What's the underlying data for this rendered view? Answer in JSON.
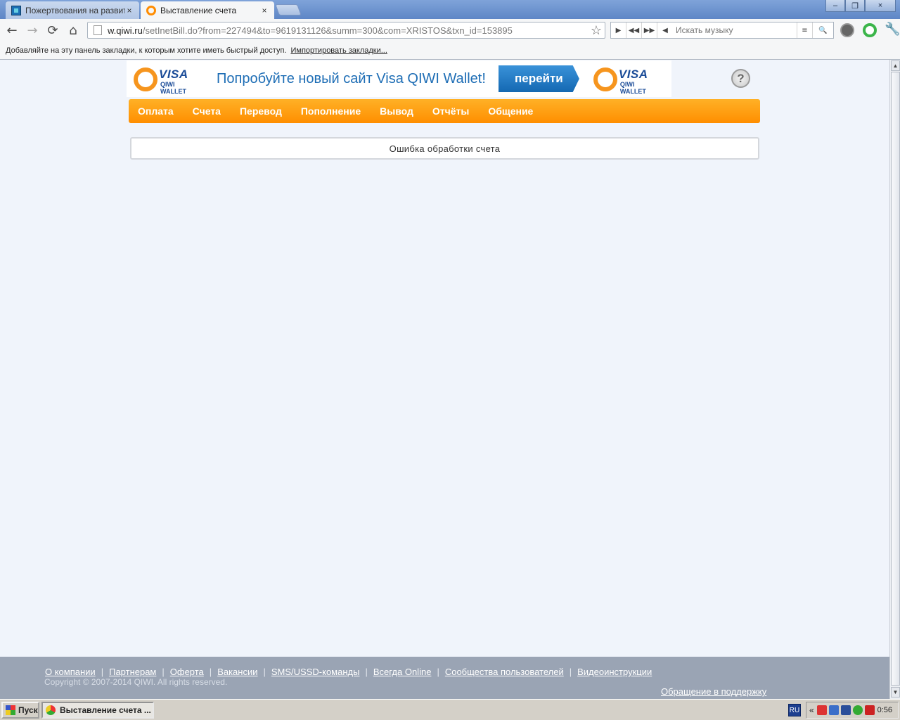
{
  "browser": {
    "tabs": [
      {
        "title": "Пожертвования на развити",
        "close": "×",
        "active": false,
        "icon": "grid-favicon"
      },
      {
        "title": "Выставление счета",
        "close": "×",
        "active": true,
        "icon": "qiwi-favicon"
      }
    ],
    "window_controls": {
      "minimize": "–",
      "maximize": "❐",
      "close": "×"
    },
    "nav": {
      "back": "←",
      "forward": "→",
      "reload": "⟳",
      "home": "⌂"
    },
    "url": {
      "host": "w.qiwi.ru",
      "path": "/setInetBill.do?from=227494&to=9619131126&summ=300&com=XRISTOS&txn_id=153895"
    },
    "star": "☆",
    "music": {
      "play": "▶",
      "prev": "◀◀",
      "next": "▶▶",
      "volume": "◀",
      "placeholder": "Искать музыку",
      "menu": "≡",
      "search": "🔍"
    },
    "wrench": "🔧",
    "bookmarks": {
      "hint": "Добавляйте на эту панель закладки, к которым хотите иметь быстрый доступ.",
      "import_link": "Импортировать закладки..."
    }
  },
  "banner": {
    "logo_visa": "VISA",
    "logo_wallet": "QIWI WALLET",
    "text": "Попробуйте новый сайт Visa QIWI Wallet!",
    "go_button": "перейти"
  },
  "help": "?",
  "nav": [
    "Оплата",
    "Счета",
    "Перевод",
    "Пополнение",
    "Вывод",
    "Отчёты",
    "Общение"
  ],
  "error_message": "Ошибка обработки счета",
  "footer": {
    "links": [
      "О компании",
      "Партнерам",
      "Оферта",
      "Вакансии",
      "SMS/USSD-команды",
      "Всегда Online",
      "Сообщества пользователей",
      "Видеоинструкции"
    ],
    "separator": "|",
    "copyright": "Copyright © 2007-2014 QIWI. All rights reserved.",
    "support": "Обращение в поддержку"
  },
  "taskbar": {
    "start": "Пуск",
    "task": "Выставление счета ...",
    "lang": "RU",
    "collapse": "«",
    "clock": "0:56"
  },
  "scrollbar": {
    "up": "▲",
    "down": "▼"
  },
  "colors": {
    "accent_orange": "#ff9a13",
    "qiwi_blue": "#1d6db5",
    "page_bg": "#f0f4fb",
    "footer_bg": "#9aa4b4"
  }
}
